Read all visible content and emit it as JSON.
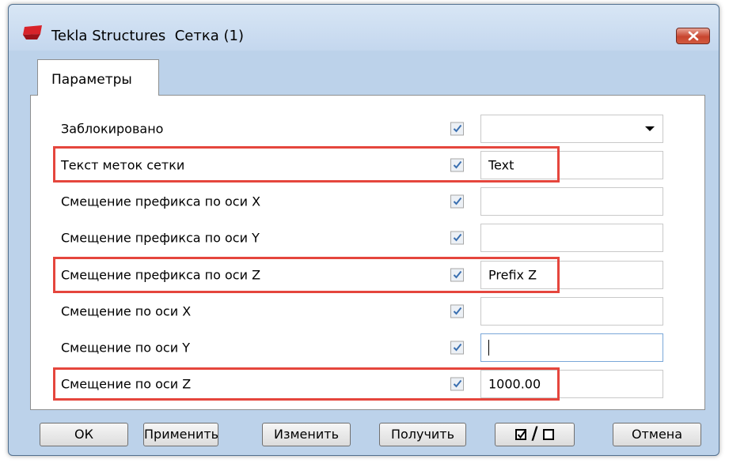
{
  "window": {
    "title": "Tekla Structures  Сетка (1)"
  },
  "tabs": [
    {
      "label": "Параметры"
    }
  ],
  "rows": [
    {
      "label": "Заблокировано",
      "checked": true,
      "value": "",
      "type": "dropdown"
    },
    {
      "label": "Текст меток сетки",
      "checked": true,
      "value": "Text",
      "type": "text"
    },
    {
      "label": "Смещение префикса по оси X",
      "checked": true,
      "value": "",
      "type": "text"
    },
    {
      "label": "Смещение префикса по оси Y",
      "checked": true,
      "value": "",
      "type": "text"
    },
    {
      "label": "Смещение префикса по оси Z",
      "checked": true,
      "value": "Prefix Z",
      "type": "text"
    },
    {
      "label": "Смещение по оси X",
      "checked": true,
      "value": "",
      "type": "text"
    },
    {
      "label": "Смещение по оси Y",
      "checked": true,
      "value": "",
      "type": "text",
      "focused": true
    },
    {
      "label": "Смещение по оси Z",
      "checked": true,
      "value": "1000.00",
      "type": "text"
    }
  ],
  "buttons": {
    "ok": "ОК",
    "apply": "Применить",
    "modify": "Изменить",
    "get": "Получить",
    "cancel": "Отмена"
  },
  "colors": {
    "highlight": "#e5463d",
    "window_frame": "#bcd2ea",
    "close_button": "#c8452f"
  }
}
